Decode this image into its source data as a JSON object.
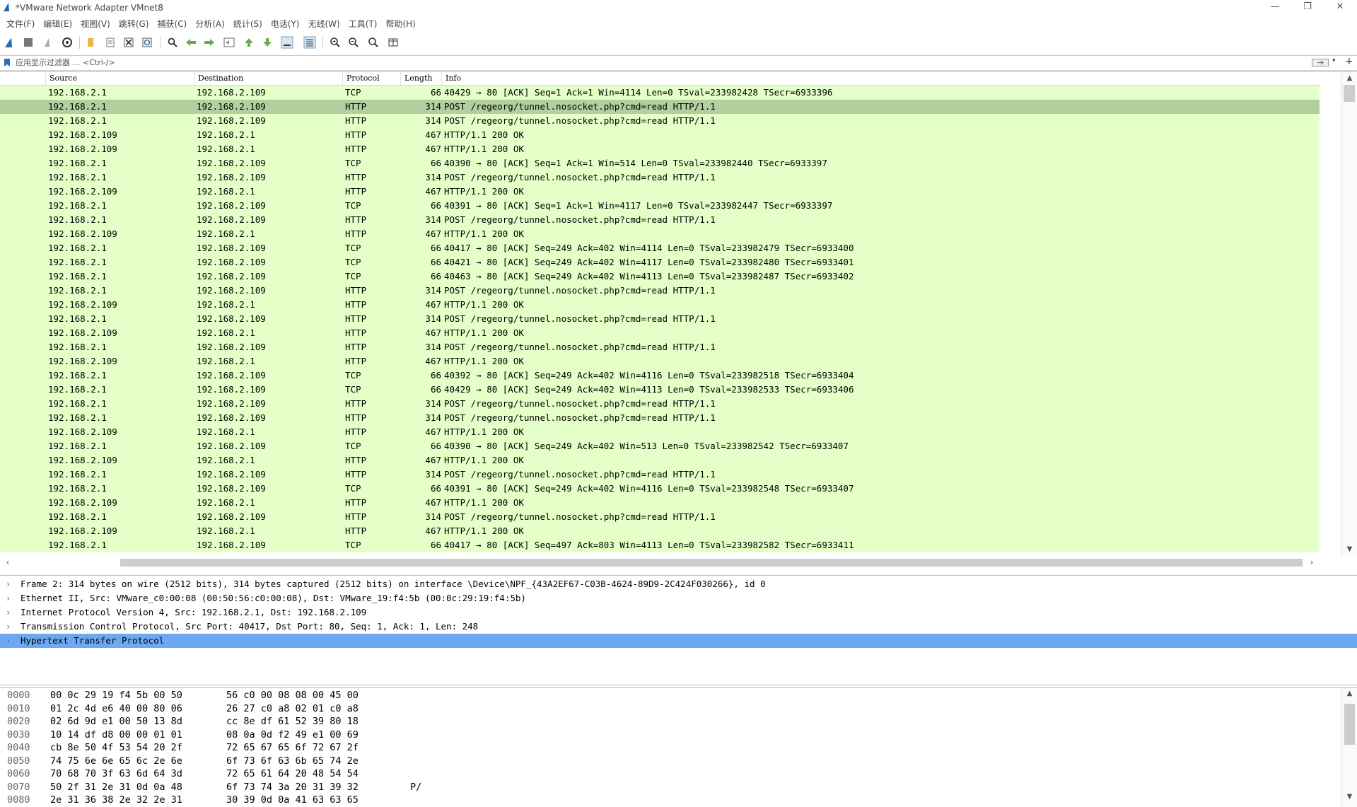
{
  "window": {
    "title": "*VMware Network Adapter VMnet8",
    "minimize": "—",
    "restore": "❐",
    "close": "✕"
  },
  "menu": [
    "文件(F)",
    "编辑(E)",
    "视图(V)",
    "跳转(G)",
    "捕获(C)",
    "分析(A)",
    "统计(S)",
    "电话(Y)",
    "无线(W)",
    "工具(T)",
    "帮助(H)"
  ],
  "toolbar": {
    "icons": [
      "shark-fin-start-icon",
      "stop-square-icon",
      "restart-capture-icon",
      "capture-options-gear-icon",
      "open-file-icon",
      "save-file-icon",
      "close-file-icon",
      "reload-icon",
      "find-icon",
      "go-back-icon",
      "go-forward-icon",
      "go-to-packet-icon",
      "first-packet-icon",
      "last-packet-icon",
      "auto-scroll-icon",
      "colorize-icon",
      "zoom-in-icon",
      "zoom-out-icon",
      "zoom-normal-icon",
      "resize-columns-icon"
    ]
  },
  "filter": {
    "placeholder": "应用显示过滤器 … <Ctrl-/>",
    "add_button": "+"
  },
  "columns": {
    "source": "Source",
    "destination": "Destination",
    "protocol": "Protocol",
    "length": "Length",
    "info": "Info"
  },
  "colors": {
    "tcp_http_row": "#e4ffc7",
    "selected_row": "#b2cfa0",
    "detail_selected": "#6fa8f2"
  },
  "packets": [
    {
      "src": "192.168.2.1",
      "dst": "192.168.2.109",
      "proto": "TCP",
      "len": "66",
      "info": "40429 → 80 [ACK] Seq=1 Ack=1 Win=4114 Len=0 TSval=233982428 TSecr=6933396"
    },
    {
      "src": "192.168.2.1",
      "dst": "192.168.2.109",
      "proto": "HTTP",
      "len": "314",
      "info": "POST /regeorg/tunnel.nosocket.php?cmd=read HTTP/1.1",
      "selected": true
    },
    {
      "src": "192.168.2.1",
      "dst": "192.168.2.109",
      "proto": "HTTP",
      "len": "314",
      "info": "POST /regeorg/tunnel.nosocket.php?cmd=read HTTP/1.1"
    },
    {
      "src": "192.168.2.109",
      "dst": "192.168.2.1",
      "proto": "HTTP",
      "len": "467",
      "info": "HTTP/1.1 200 OK"
    },
    {
      "src": "192.168.2.109",
      "dst": "192.168.2.1",
      "proto": "HTTP",
      "len": "467",
      "info": "HTTP/1.1 200 OK"
    },
    {
      "src": "192.168.2.1",
      "dst": "192.168.2.109",
      "proto": "TCP",
      "len": "66",
      "info": "40390 → 80 [ACK] Seq=1 Ack=1 Win=514 Len=0 TSval=233982440 TSecr=6933397"
    },
    {
      "src": "192.168.2.1",
      "dst": "192.168.2.109",
      "proto": "HTTP",
      "len": "314",
      "info": "POST /regeorg/tunnel.nosocket.php?cmd=read HTTP/1.1"
    },
    {
      "src": "192.168.2.109",
      "dst": "192.168.2.1",
      "proto": "HTTP",
      "len": "467",
      "info": "HTTP/1.1 200 OK"
    },
    {
      "src": "192.168.2.1",
      "dst": "192.168.2.109",
      "proto": "TCP",
      "len": "66",
      "info": "40391 → 80 [ACK] Seq=1 Ack=1 Win=4117 Len=0 TSval=233982447 TSecr=6933397"
    },
    {
      "src": "192.168.2.1",
      "dst": "192.168.2.109",
      "proto": "HTTP",
      "len": "314",
      "info": "POST /regeorg/tunnel.nosocket.php?cmd=read HTTP/1.1"
    },
    {
      "src": "192.168.2.109",
      "dst": "192.168.2.1",
      "proto": "HTTP",
      "len": "467",
      "info": "HTTP/1.1 200 OK"
    },
    {
      "src": "192.168.2.1",
      "dst": "192.168.2.109",
      "proto": "TCP",
      "len": "66",
      "info": "40417 → 80 [ACK] Seq=249 Ack=402 Win=4114 Len=0 TSval=233982479 TSecr=6933400"
    },
    {
      "src": "192.168.2.1",
      "dst": "192.168.2.109",
      "proto": "TCP",
      "len": "66",
      "info": "40421 → 80 [ACK] Seq=249 Ack=402 Win=4117 Len=0 TSval=233982480 TSecr=6933401"
    },
    {
      "src": "192.168.2.1",
      "dst": "192.168.2.109",
      "proto": "TCP",
      "len": "66",
      "info": "40463 → 80 [ACK] Seq=249 Ack=402 Win=4113 Len=0 TSval=233982487 TSecr=6933402"
    },
    {
      "src": "192.168.2.1",
      "dst": "192.168.2.109",
      "proto": "HTTP",
      "len": "314",
      "info": "POST /regeorg/tunnel.nosocket.php?cmd=read HTTP/1.1"
    },
    {
      "src": "192.168.2.109",
      "dst": "192.168.2.1",
      "proto": "HTTP",
      "len": "467",
      "info": "HTTP/1.1 200 OK"
    },
    {
      "src": "192.168.2.1",
      "dst": "192.168.2.109",
      "proto": "HTTP",
      "len": "314",
      "info": "POST /regeorg/tunnel.nosocket.php?cmd=read HTTP/1.1"
    },
    {
      "src": "192.168.2.109",
      "dst": "192.168.2.1",
      "proto": "HTTP",
      "len": "467",
      "info": "HTTP/1.1 200 OK"
    },
    {
      "src": "192.168.2.1",
      "dst": "192.168.2.109",
      "proto": "HTTP",
      "len": "314",
      "info": "POST /regeorg/tunnel.nosocket.php?cmd=read HTTP/1.1"
    },
    {
      "src": "192.168.2.109",
      "dst": "192.168.2.1",
      "proto": "HTTP",
      "len": "467",
      "info": "HTTP/1.1 200 OK"
    },
    {
      "src": "192.168.2.1",
      "dst": "192.168.2.109",
      "proto": "TCP",
      "len": "66",
      "info": "40392 → 80 [ACK] Seq=249 Ack=402 Win=4116 Len=0 TSval=233982518 TSecr=6933404"
    },
    {
      "src": "192.168.2.1",
      "dst": "192.168.2.109",
      "proto": "TCP",
      "len": "66",
      "info": "40429 → 80 [ACK] Seq=249 Ack=402 Win=4113 Len=0 TSval=233982533 TSecr=6933406"
    },
    {
      "src": "192.168.2.1",
      "dst": "192.168.2.109",
      "proto": "HTTP",
      "len": "314",
      "info": "POST /regeorg/tunnel.nosocket.php?cmd=read HTTP/1.1"
    },
    {
      "src": "192.168.2.1",
      "dst": "192.168.2.109",
      "proto": "HTTP",
      "len": "314",
      "info": "POST /regeorg/tunnel.nosocket.php?cmd=read HTTP/1.1"
    },
    {
      "src": "192.168.2.109",
      "dst": "192.168.2.1",
      "proto": "HTTP",
      "len": "467",
      "info": "HTTP/1.1 200 OK"
    },
    {
      "src": "192.168.2.1",
      "dst": "192.168.2.109",
      "proto": "TCP",
      "len": "66",
      "info": "40390 → 80 [ACK] Seq=249 Ack=402 Win=513 Len=0 TSval=233982542 TSecr=6933407"
    },
    {
      "src": "192.168.2.109",
      "dst": "192.168.2.1",
      "proto": "HTTP",
      "len": "467",
      "info": "HTTP/1.1 200 OK"
    },
    {
      "src": "192.168.2.1",
      "dst": "192.168.2.109",
      "proto": "HTTP",
      "len": "314",
      "info": "POST /regeorg/tunnel.nosocket.php?cmd=read HTTP/1.1"
    },
    {
      "src": "192.168.2.1",
      "dst": "192.168.2.109",
      "proto": "TCP",
      "len": "66",
      "info": "40391 → 80 [ACK] Seq=249 Ack=402 Win=4116 Len=0 TSval=233982548 TSecr=6933407"
    },
    {
      "src": "192.168.2.109",
      "dst": "192.168.2.1",
      "proto": "HTTP",
      "len": "467",
      "info": "HTTP/1.1 200 OK"
    },
    {
      "src": "192.168.2.1",
      "dst": "192.168.2.109",
      "proto": "HTTP",
      "len": "314",
      "info": "POST /regeorg/tunnel.nosocket.php?cmd=read HTTP/1.1"
    },
    {
      "src": "192.168.2.109",
      "dst": "192.168.2.1",
      "proto": "HTTP",
      "len": "467",
      "info": "HTTP/1.1 200 OK"
    },
    {
      "src": "192.168.2.1",
      "dst": "192.168.2.109",
      "proto": "TCP",
      "len": "66",
      "info": "40417 → 80 [ACK] Seq=497 Ack=803 Win=4113 Len=0 TSval=233982582 TSecr=6933411"
    }
  ],
  "details": [
    {
      "text": "Frame 2: 314 bytes on wire (2512 bits), 314 bytes captured (2512 bits) on interface \\Device\\NPF_{43A2EF67-C03B-4624-89D9-2C424F030266}, id 0"
    },
    {
      "text": "Ethernet II, Src: VMware_c0:00:08 (00:50:56:c0:00:08), Dst: VMware_19:f4:5b (00:0c:29:19:f4:5b)"
    },
    {
      "text": "Internet Protocol Version 4, Src: 192.168.2.1, Dst: 192.168.2.109"
    },
    {
      "text": "Transmission Control Protocol, Src Port: 40417, Dst Port: 80, Seq: 1, Ack: 1, Len: 248"
    },
    {
      "text": "Hypertext Transfer Protocol",
      "selected": true
    }
  ],
  "bytes": [
    {
      "off": "0000",
      "h1": "00 0c 29 19 f4 5b 00 50",
      "h2": "56 c0 00 08 08 00 45 00",
      "ascii": ""
    },
    {
      "off": "0010",
      "h1": "01 2c 4d e6 40 00 80 06",
      "h2": "26 27 c0 a8 02 01 c0 a8",
      "ascii": ""
    },
    {
      "off": "0020",
      "h1": "02 6d 9d e1 00 50 13 8d",
      "h2": "cc 8e df 61 52 39 80 18",
      "ascii": ""
    },
    {
      "off": "0030",
      "h1": "10 14 df d8 00 00 01 01",
      "h2": "08 0a 0d f2 49 e1 00 69",
      "ascii": ""
    },
    {
      "off": "0040",
      "h1": "cb 8e 50 4f 53 54 20 2f",
      "h2": "72 65 67 65 6f 72 67 2f",
      "ascii": ""
    },
    {
      "off": "0050",
      "h1": "74 75 6e 6e 65 6c 2e 6e",
      "h2": "6f 73 6f 63 6b 65 74 2e",
      "ascii": ""
    },
    {
      "off": "0060",
      "h1": "70 68 70 3f 63 6d 64 3d",
      "h2": "72 65 61 64 20 48 54 54",
      "ascii": ""
    },
    {
      "off": "0070",
      "h1": "50 2f 31 2e 31 0d 0a 48",
      "h2": "6f 73 74 3a 20 31 39 32",
      "ascii": "P/"
    },
    {
      "off": "0080",
      "h1": "2e 31 36 38 2e 32 2e 31",
      "h2": "30 39 0d 0a 41 63 63 65",
      "ascii": ""
    }
  ]
}
